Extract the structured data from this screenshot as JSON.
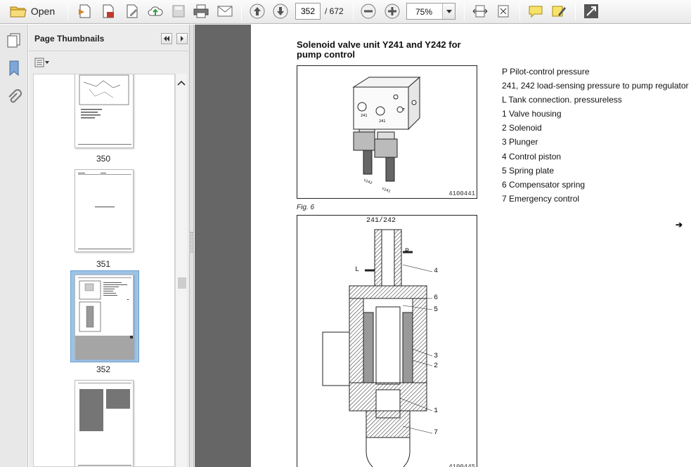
{
  "toolbar": {
    "open_label": "Open",
    "current_page": "352",
    "page_total": "/ 672",
    "zoom": "75%"
  },
  "thumbnails": {
    "title": "Page Thumbnails",
    "pages": [
      {
        "label": "350"
      },
      {
        "label": "351"
      },
      {
        "label": "352"
      }
    ],
    "selected_page": "352"
  },
  "document": {
    "title": "Solenoid valve unit Y241 and Y242 for pump control",
    "figure1": {
      "number": "4100441",
      "caption": "Fig. 6"
    },
    "figure2": {
      "number": "4100445",
      "top_label": "241/242",
      "callouts": [
        "P",
        "L",
        "4",
        "6",
        "5",
        "3",
        "2",
        "1",
        "7"
      ]
    },
    "legend": [
      "P Pilot-control pressure",
      "241, 242 load-sensing pressure to pump regulator",
      "L Tank connection. pressureless",
      "1 Valve housing",
      "2 Solenoid",
      "3 Plunger",
      "4 Control piston",
      "5 Spring plate",
      "6 Compensator spring",
      "7 Emergency control"
    ],
    "continue_arrow": "➔"
  }
}
